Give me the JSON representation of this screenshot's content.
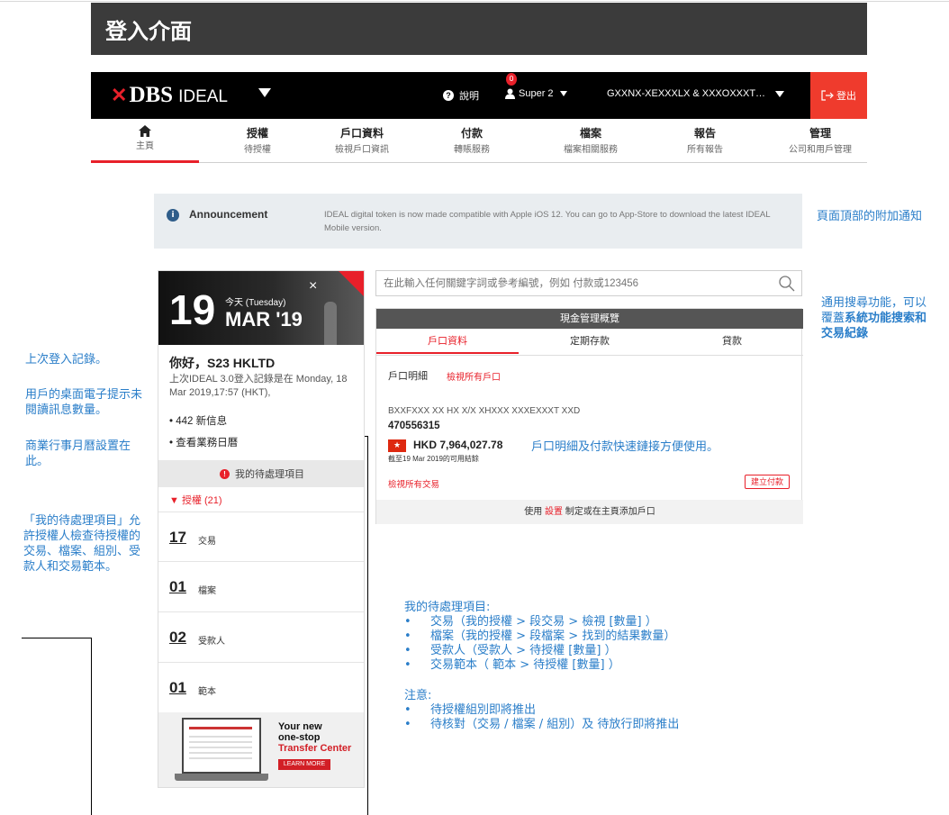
{
  "page_title": "登入介面",
  "navbar": {
    "logo_mark": "✕",
    "logo_text": "DBS",
    "logo_sub": "IDEAL",
    "help_label": "說明",
    "notification_count": "0",
    "user_name": "Super 2",
    "account_name": "GXXNX-XEXXXLX & XXXOXXXT…",
    "logout_label": "登出"
  },
  "menu": [
    {
      "title": "",
      "sub": "主頁"
    },
    {
      "title": "授權",
      "sub": "待授權"
    },
    {
      "title": "戶口資料",
      "sub": "檢視戶口資訊"
    },
    {
      "title": "付款",
      "sub": "轉賬服務"
    },
    {
      "title": "檔案",
      "sub": "檔案相關服務"
    },
    {
      "title": "報告",
      "sub": "所有報告"
    },
    {
      "title": "管理",
      "sub": "公司和用戶管理"
    }
  ],
  "announcement": {
    "title": "Announcement",
    "text": "IDEAL digital token is now made compatible with Apple iOS 12. You can go to App-Store to download the latest IDEAL Mobile version."
  },
  "notes": {
    "announcement": "頁面頂部的附加通知",
    "search_prefix": "通用搜尋功能，可以覆蓋",
    "search_bold": "系統功能搜索和交易紀錄",
    "last_login": "上次登入記錄。",
    "unread": "用戶的桌面電子提示未閱讀訊息數量。",
    "calendar": "商業行事月曆設置在此。",
    "pending": "「我的待處理項目」允許授權人檢查待授權的交易、檔案、組別、受款人和交易範本。",
    "quick_links": "戶口明細及付款快速鏈接方便使用。",
    "pending_list_title": "我的待處理項目:",
    "pending_list": [
      "交易（我的授權 > 段交易 > 檢視 [數量] ）",
      "檔案（我的授權 > 段檔案 > 找到的結果數量）",
      "受款人（受款人 > 待授權 [數量] ）",
      "交易範本（ 範本  > 待授權 [數量] ）"
    ],
    "attention_title": "注意:",
    "attention_list": [
      "待授權組別即將推出",
      "待核對（交易 / 檔案 / 組別）及 待放行即將推出"
    ]
  },
  "hero": {
    "day": "19",
    "today": "今天 (Tuesday)",
    "month": "MAR '19",
    "close": "×"
  },
  "greeting": "你好，S23 HKLTD",
  "last_login_text": "上次IDEAL 3.0登入記錄是在 Monday, 18 Mar 2019,17:57 (HKT),",
  "messages_item": "442 新信息",
  "calendar_item": "查看業務日曆",
  "pending": {
    "head": "我的待處理項目",
    "badge": "!",
    "sub": "▼ 授權 (21)",
    "items": [
      {
        "num": "17",
        "label": "交易"
      },
      {
        "num": "01",
        "label": "檔案"
      },
      {
        "num": "02",
        "label": "受款人"
      },
      {
        "num": "01",
        "label": "範本"
      }
    ]
  },
  "promo": {
    "line1": "Your new",
    "line2": "one-stop",
    "line3": "Transfer Center",
    "button": "LEARN MORE"
  },
  "search": {
    "placeholder": "在此輸入任何關鍵字詞或參考編號，例如 付款或123456"
  },
  "cash": {
    "head": "現金管理概覽",
    "tabs": [
      "戶口資料",
      "定期存款",
      "貸款"
    ],
    "details_label": "戶口明細",
    "view_all_accounts": "檢視所有戶口",
    "account_name": "BXXFXXX XX HX X/X XHXXX XXXEXXXT XXD",
    "account_no": "470556315",
    "flag": "★",
    "balance": "HKD 7,964,027.78",
    "balance_note": "截至19 Mar 2019的可用結餘",
    "view_all_tx": "檢視所有交易",
    "create_payment": "建立付款",
    "foot_pre": "使用",
    "foot_link": "設置",
    "foot_post": "制定或在主頁添加戶口"
  },
  "colors": {
    "brand_red": "#e8202a",
    "note_blue": "#2a7ec9",
    "navbar_bg": "#000000",
    "title_bg": "#3b3b3b"
  }
}
